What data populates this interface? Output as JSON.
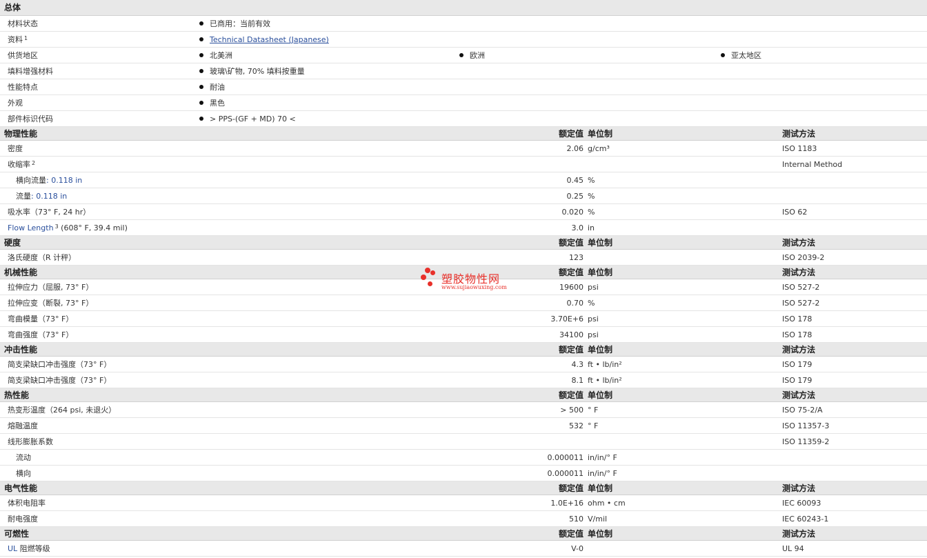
{
  "general": {
    "title": "总体",
    "rows": [
      {
        "label": "材料状态",
        "items": [
          "已商用：当前有效"
        ]
      },
      {
        "label": "资料",
        "sup": "1",
        "link": "Technical Datasheet (Japanese)"
      },
      {
        "label": "供货地区",
        "items": [
          "北美洲",
          "欧洲",
          "亚太地区"
        ]
      },
      {
        "label": "填料增强材料",
        "items": [
          "玻璃\\矿物, 70% 填料按重量"
        ]
      },
      {
        "label": "性能特点",
        "items": [
          "耐油"
        ]
      },
      {
        "label": "外观",
        "items": [
          "黑色"
        ]
      },
      {
        "label": "部件标识代码",
        "items": [
          "> PPS-(GF + MD) 70 <"
        ]
      }
    ]
  },
  "headers": {
    "value": "额定值",
    "unit": "单位制",
    "test": "测试方法"
  },
  "physical": {
    "title": "物理性能",
    "rows": [
      {
        "label": "密度",
        "value": "2.06",
        "unit": "g/cm³",
        "test": "ISO 1183"
      },
      {
        "label": "收缩率",
        "sup": "2",
        "test": "Internal Method"
      },
      {
        "label_cn": "横向流量",
        "label_en": ": 0.118 in",
        "value": "0.45",
        "unit": "%"
      },
      {
        "label_cn": "流量",
        "label_en": ": 0.118 in",
        "value": "0.25",
        "unit": "%"
      },
      {
        "label": "吸水率（73° F, 24 hr）",
        "value": "0.020",
        "unit": "%",
        "test": "ISO 62"
      },
      {
        "label_en": "Flow Length",
        "sup": "3",
        "label": "(608° F, 39.4 mil)",
        "value": "3.0",
        "unit": "in"
      }
    ]
  },
  "hardness": {
    "title": "硬度",
    "rows": [
      {
        "label": "洛氏硬度（R 计秤）",
        "value": "123",
        "test": "ISO 2039-2"
      }
    ]
  },
  "mechanical": {
    "title": "机械性能",
    "rows": [
      {
        "label": "拉伸应力（屈服, 73° F）",
        "value": "19600",
        "unit": "psi",
        "test": "ISO 527-2"
      },
      {
        "label": "拉伸应变（断裂, 73° F）",
        "value": "0.70",
        "unit": "%",
        "test": "ISO 527-2"
      },
      {
        "label": "弯曲模量（73° F）",
        "value": "3.70E+6",
        "unit": "psi",
        "test": "ISO 178"
      },
      {
        "label": "弯曲强度（73° F）",
        "value": "34100",
        "unit": "psi",
        "test": "ISO 178"
      }
    ]
  },
  "impact": {
    "title": "冲击性能",
    "rows": [
      {
        "label": "简支梁缺口冲击强度（73° F）",
        "value": "4.3",
        "unit": "ft • lb/in²",
        "test": "ISO 179"
      },
      {
        "label": "简支梁缺口冲击强度（73° F）",
        "value": "8.1",
        "unit": "ft • lb/in²",
        "test": "ISO 179"
      }
    ]
  },
  "thermal": {
    "title": "热性能",
    "rows": [
      {
        "label": "热变形温度（264 psi, 未退火）",
        "value": "> 500",
        "unit": "° F",
        "test": "ISO 75-2/A"
      },
      {
        "label": "熔融温度",
        "value": "532",
        "unit": "° F",
        "test": "ISO 11357-3"
      },
      {
        "label": "线形膨胀系数",
        "test": "ISO 11359-2"
      },
      {
        "label": "流动",
        "value": "0.000011",
        "unit": "in/in/° F"
      },
      {
        "label": "横向",
        "value": "0.000011",
        "unit": "in/in/° F"
      }
    ]
  },
  "electrical": {
    "title": "电气性能",
    "rows": [
      {
        "label": "体积电阻率",
        "value": "1.0E+16",
        "unit": "ohm • cm",
        "test": "IEC 60093"
      },
      {
        "label": "耐电强度",
        "value": "510",
        "unit": "V/mil",
        "test": "IEC 60243-1"
      }
    ]
  },
  "flammability": {
    "title": "可燃性",
    "rows": [
      {
        "label_en": "UL",
        "label": " 阻燃等级",
        "value": "V-0",
        "test": "UL 94"
      }
    ]
  },
  "watermark": {
    "name": "塑胶物性网",
    "url": "www.sujiaowuxing.com",
    "color": "#e8302a"
  }
}
